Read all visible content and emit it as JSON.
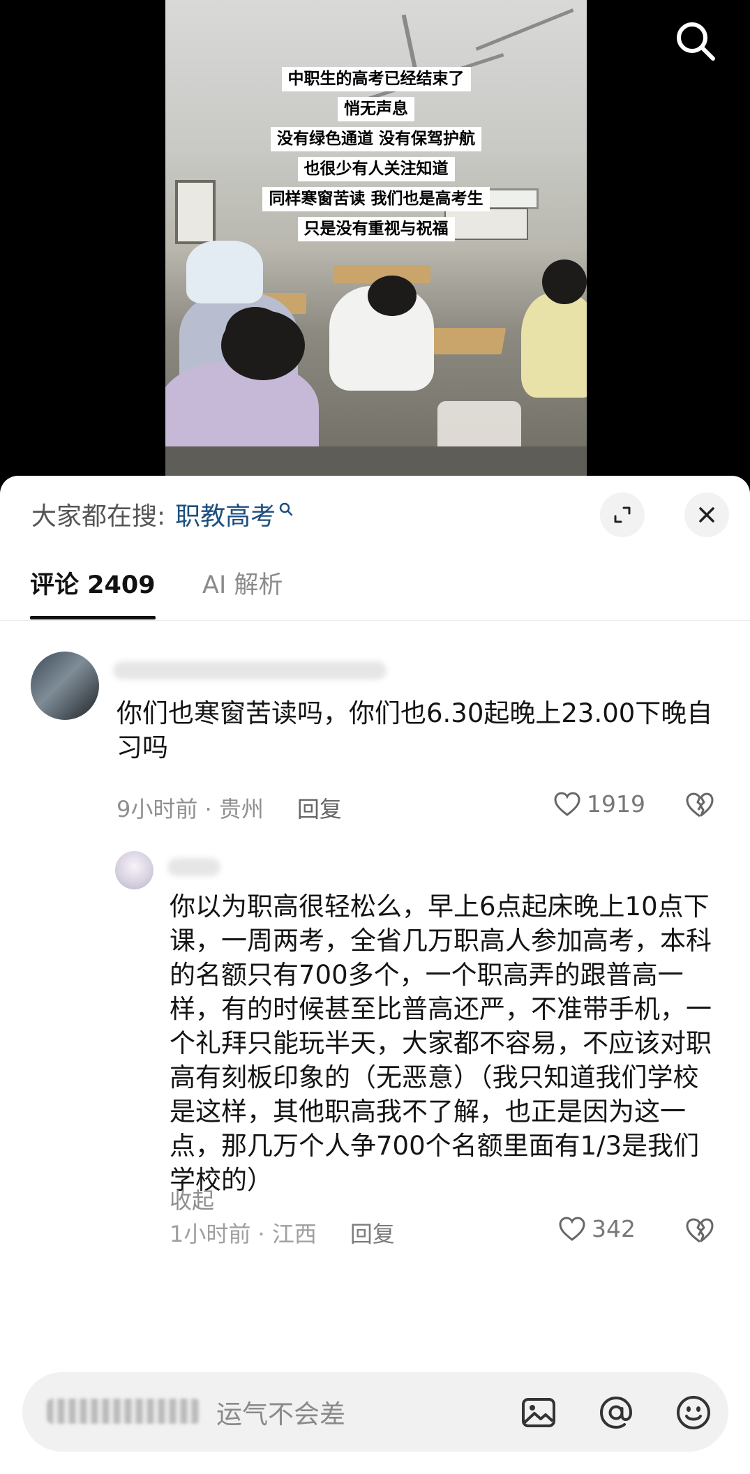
{
  "video": {
    "captions": [
      "中职生的高考已经结束了",
      "悄无声息",
      "没有绿色通道 没有保驾护航",
      "也很少有人关注知道",
      "同样寒窗苦读 我们也是高考生",
      "只是没有重视与祝福"
    ],
    "icons": {
      "search": "search-icon"
    }
  },
  "sheet": {
    "hot_search_prefix": "大家都在搜:",
    "hot_search_term": "职教高考",
    "icons": {
      "expand": "expand-icon",
      "close": "close-icon"
    }
  },
  "tabs": {
    "comments": "评论 2409",
    "ai": "AI 解析"
  },
  "comments": [
    {
      "text": "你们也寒窗苦读吗，你们也6.30起晚上23.00下晚自习吗",
      "time_location": "9小时前 · 贵州",
      "reply_label": "回复",
      "likes": "1919"
    },
    {
      "text": "你以为职高很轻松么，早上6点起床晚上10点下课，一周两考，全省几万职高人参加高考，本科的名额只有700多个，一个职高弄的跟普高一样，有的时候甚至比普高还严，不准带手机，一个礼拜只能玩半天，大家都不容易，不应该对职高有刻板印象的（无恶意）（我只知道我们学校是这样，其他职高我不了解，也正是因为这一点，那几万个人争700个名额里面有1/3是我们学校的）",
      "collapse_label": "收起",
      "time_location": "1小时前 · 江西",
      "reply_label": "回复",
      "likes": "342"
    }
  ],
  "input": {
    "placeholder": "运气不会差",
    "icons": {
      "image": "image-icon",
      "mention": "at-icon",
      "emoji": "emoji-icon"
    }
  },
  "colors": {
    "hot_search_term": "#1d4f7f",
    "sheet_bg": "#ffffff",
    "input_bg": "#f1f1f1"
  }
}
